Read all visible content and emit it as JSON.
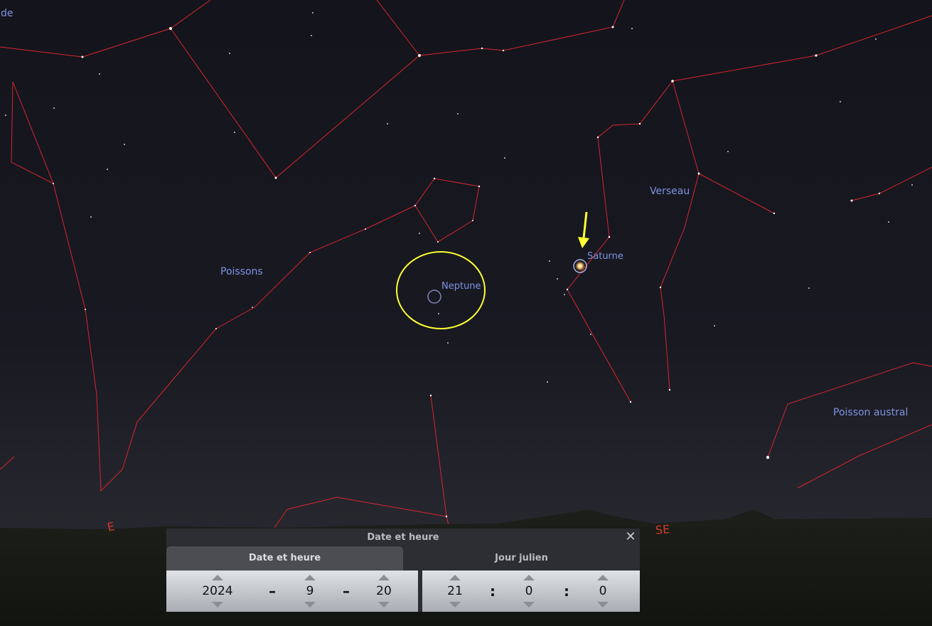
{
  "sky": {
    "labels": {
      "edge_label": "de",
      "poissons": "Poissons",
      "neptune": "Neptune",
      "saturne": "Saturne",
      "verseau": "Verseau",
      "poisson_austral": "Poisson austral"
    },
    "cardinals": {
      "east": "E",
      "southeast": "SE"
    },
    "colors": {
      "constellation_lines": "#d7262b",
      "labels": "#7e93e0",
      "highlight": "#ffff33",
      "cardinal": "#d23a2a"
    }
  },
  "dialog": {
    "title": "Date et heure",
    "close_label": "✕",
    "tabs": [
      {
        "label": "Date et heure"
      },
      {
        "label": "Jour julien"
      }
    ],
    "date": {
      "year": "2024",
      "month": "9",
      "day": "20",
      "separator": "–"
    },
    "time": {
      "hour": "21",
      "minute": "0",
      "second": "0",
      "separator": ":"
    }
  }
}
